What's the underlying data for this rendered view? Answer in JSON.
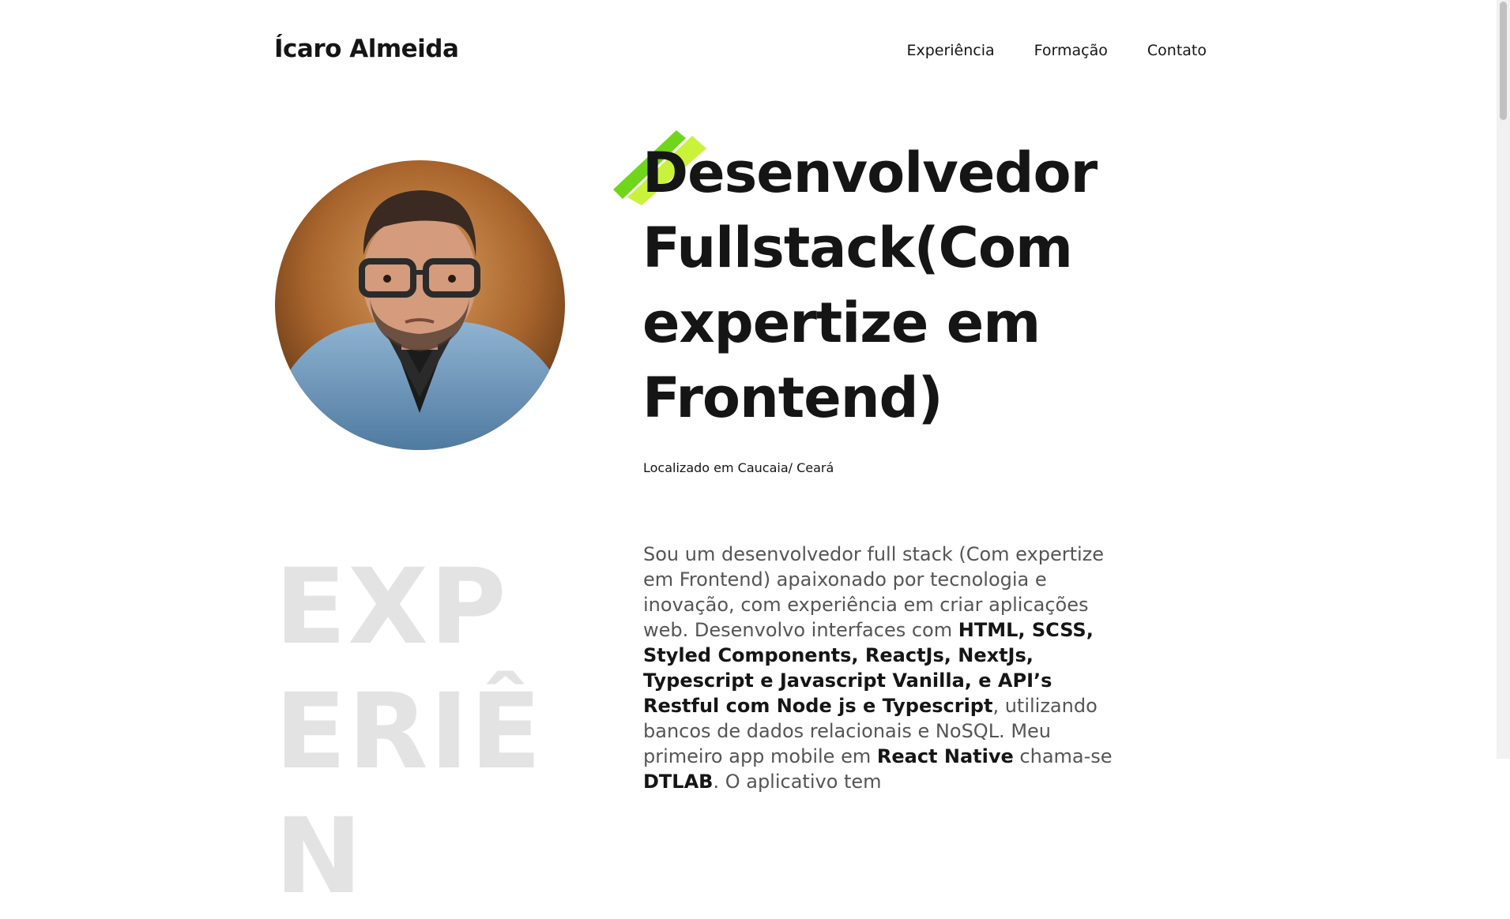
{
  "header": {
    "brand": "Ícaro Almeida",
    "nav": [
      "Experiência",
      "Formação",
      "Contato"
    ]
  },
  "hero": {
    "title": "Desenvolvedor Fullstack(Com expertize em Frontend)",
    "location": "Localizado em Caucaia/ Ceará",
    "accent_color": "#6fd61a",
    "accent_color_light": "#c9f23a"
  },
  "about": {
    "ghost_label": "EXPERIÊN",
    "p1": "Sou um desenvolvedor full stack (Com expertize em Frontend) apaixonado por tecnologia e inovação, com experiência em criar aplicações web. Desenvolvo interfaces com",
    "b1": "HTML, SCSS, Styled Components, ReactJs, NextJs, Typescript e Javascript Vanilla, e API’s Restful com Node js e Typescript",
    "p2": ", utilizando bancos de dados relacionais e NoSQL. Meu primeiro app mobile em",
    "b2": "React Native",
    "p3": "chama-se",
    "b3": "DTLAB",
    "p4": ". O aplicativo tem"
  }
}
